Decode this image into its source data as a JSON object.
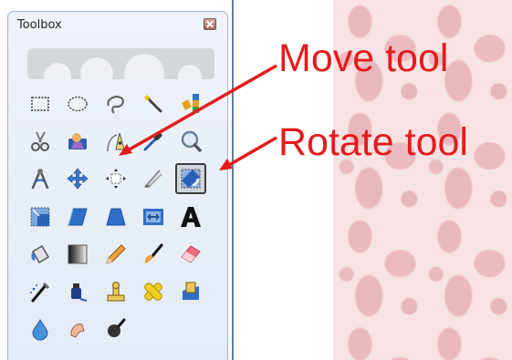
{
  "toolbox": {
    "title": "Toolbox",
    "close_icon": "close-icon",
    "tools": [
      {
        "row": 0,
        "col": 0,
        "icon": "rect-select-icon"
      },
      {
        "row": 0,
        "col": 1,
        "icon": "ellipse-select-icon"
      },
      {
        "row": 0,
        "col": 2,
        "icon": "free-select-icon"
      },
      {
        "row": 0,
        "col": 3,
        "icon": "fuzzy-select-icon"
      },
      {
        "row": 0,
        "col": 4,
        "icon": "select-by-color-icon"
      },
      {
        "row": 1,
        "col": 0,
        "icon": "scissors-select-icon"
      },
      {
        "row": 1,
        "col": 1,
        "icon": "foreground-select-icon"
      },
      {
        "row": 1,
        "col": 2,
        "icon": "paths-icon"
      },
      {
        "row": 1,
        "col": 3,
        "icon": "color-picker-icon"
      },
      {
        "row": 1,
        "col": 4,
        "icon": "zoom-icon"
      },
      {
        "row": 2,
        "col": 0,
        "icon": "measure-icon"
      },
      {
        "row": 2,
        "col": 1,
        "icon": "move-icon"
      },
      {
        "row": 2,
        "col": 2,
        "icon": "align-icon"
      },
      {
        "row": 2,
        "col": 3,
        "icon": "crop-icon"
      },
      {
        "row": 2,
        "col": 4,
        "icon": "rotate-icon",
        "active": true
      },
      {
        "row": 3,
        "col": 0,
        "icon": "scale-icon"
      },
      {
        "row": 3,
        "col": 1,
        "icon": "shear-icon"
      },
      {
        "row": 3,
        "col": 2,
        "icon": "perspective-icon"
      },
      {
        "row": 3,
        "col": 3,
        "icon": "flip-icon"
      },
      {
        "row": 3,
        "col": 4,
        "icon": "text-icon"
      },
      {
        "row": 4,
        "col": 0,
        "icon": "bucket-fill-icon"
      },
      {
        "row": 4,
        "col": 1,
        "icon": "blend-icon"
      },
      {
        "row": 4,
        "col": 2,
        "icon": "pencil-icon"
      },
      {
        "row": 4,
        "col": 3,
        "icon": "paintbrush-icon"
      },
      {
        "row": 4,
        "col": 4,
        "icon": "eraser-icon"
      },
      {
        "row": 5,
        "col": 0,
        "icon": "airbrush-icon"
      },
      {
        "row": 5,
        "col": 1,
        "icon": "ink-icon"
      },
      {
        "row": 5,
        "col": 2,
        "icon": "clone-icon"
      },
      {
        "row": 5,
        "col": 3,
        "icon": "heal-icon"
      },
      {
        "row": 5,
        "col": 4,
        "icon": "perspective-clone-icon"
      },
      {
        "row": 6,
        "col": 0,
        "icon": "blur-sharpen-icon"
      },
      {
        "row": 6,
        "col": 1,
        "icon": "smudge-icon"
      },
      {
        "row": 6,
        "col": 2,
        "icon": "dodge-burn-icon"
      }
    ]
  },
  "annotations": {
    "move": "Move tool",
    "rotate": "Rotate tool",
    "color": "#e51b1b"
  }
}
